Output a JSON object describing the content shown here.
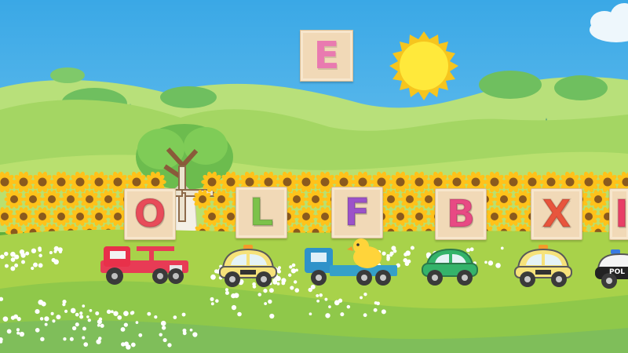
{
  "target_letter": {
    "text": "E",
    "color": "#e97ab0"
  },
  "letter_blocks": [
    {
      "text": "O",
      "color": "#e84c5a"
    },
    {
      "text": "L",
      "color": "#7cc24a"
    },
    {
      "text": "F",
      "color": "#9b52c9"
    },
    {
      "text": "B",
      "color": "#e84a84"
    },
    {
      "text": "X",
      "color": "#e8553d"
    },
    {
      "text": "I",
      "color": "#e83f66"
    }
  ],
  "vehicles": {
    "crane_truck": {
      "color": "#e8304a"
    },
    "taxi_1": {
      "color": "#f6e27a"
    },
    "duck_truck": {
      "color": "#2f92c9"
    },
    "green_car": {
      "color": "#34b36a"
    },
    "taxi_2": {
      "color": "#f6e27a"
    },
    "police_car": {
      "label": "POL"
    }
  },
  "colors": {
    "sky": "#56b8ea",
    "sun": "#ffe53b",
    "hill": "#9ed86a",
    "road": "#a8d24a"
  }
}
